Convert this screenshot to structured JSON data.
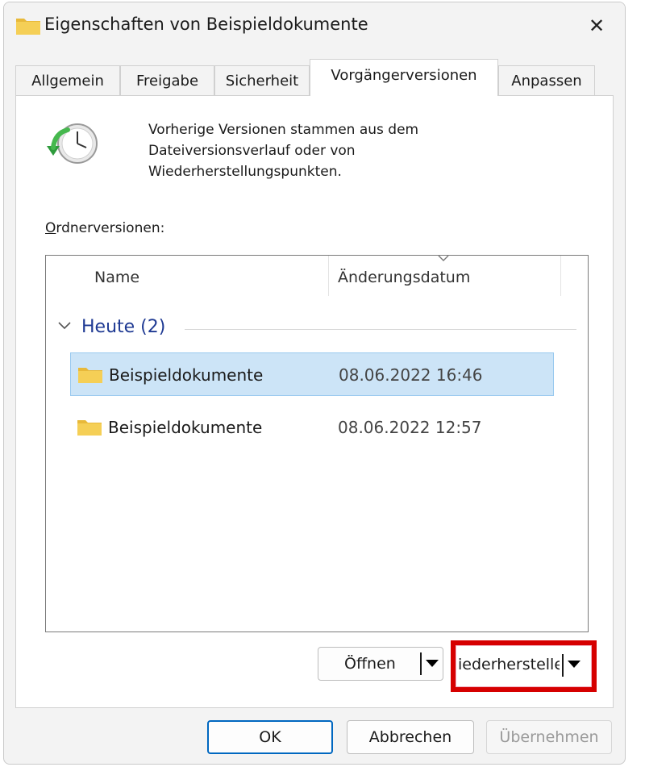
{
  "window": {
    "title": "Eigenschaften von Beispieldokumente",
    "title_icon": "folder-icon",
    "close_glyph": "✕"
  },
  "tabs": [
    {
      "label": "Allgemein",
      "active": false
    },
    {
      "label": "Freigabe",
      "active": false
    },
    {
      "label": "Sicherheit",
      "active": false
    },
    {
      "label": "Vorgängerversionen",
      "active": true
    },
    {
      "label": "Anpassen",
      "active": false
    }
  ],
  "info": {
    "icon": "clock-restore-icon",
    "lines": [
      "Vorherige Versionen stammen aus dem",
      "Dateiversionsverlauf oder von",
      "Wiederherstellungspunkten."
    ]
  },
  "list": {
    "caption_first": "O",
    "caption_rest": "rdnerversionen:",
    "columns": [
      "Name",
      "Änderungsdatum"
    ],
    "group": "Heute (2)",
    "rows": [
      {
        "name": "Beispieldokumente",
        "date": "08.06.2022 16:46",
        "selected": true
      },
      {
        "name": "Beispieldokumente",
        "date": "08.06.2022 12:57",
        "selected": false
      }
    ]
  },
  "actions": {
    "open_label": "Öffnen",
    "restore_label": "iederherstellen"
  },
  "footer": {
    "ok": "OK",
    "cancel": "Abbrechen",
    "apply": "Übernehmen"
  },
  "colors": {
    "selection": "#cce4f7",
    "highlight_frame": "#d60000",
    "group_title": "#1f3a93",
    "primary_border": "#0067c0"
  }
}
